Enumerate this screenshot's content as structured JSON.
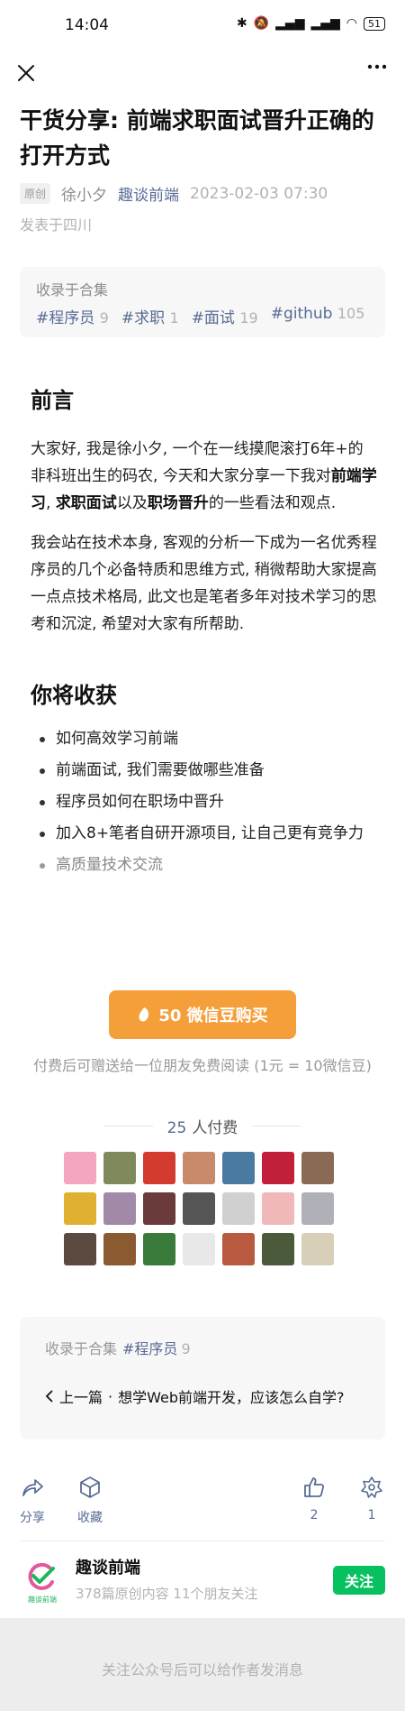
{
  "status_bar": {
    "time": "14:04",
    "icons": [
      "bluetooth-icon",
      "mute-icon",
      "hd-signal-icon",
      "hd-signal-icon",
      "wifi-icon"
    ],
    "battery": "51"
  },
  "nav": {
    "close_icon": "close-icon",
    "more_icon": "more-icon"
  },
  "article": {
    "title": "干货分享: 前端求职面试晋升正确的打开方式",
    "original_tag": "原创",
    "author": "徐小夕",
    "account": "趣谈前端",
    "date": "2023-02-03 07:30",
    "location": "发表于四川"
  },
  "collection": {
    "label": "收录于合集",
    "tags": [
      {
        "name": "#程序员",
        "count": "9"
      },
      {
        "name": "#求职",
        "count": "1"
      },
      {
        "name": "#面试",
        "count": "19"
      },
      {
        "name": "#github",
        "count": "105"
      }
    ]
  },
  "content": {
    "section1_title": "前言",
    "para1": {
      "t1": "大家好, 我是徐小夕, 一个在一线摸爬滚打6年+的非科班出生的码农, 今天和大家分享一下我对",
      "b1": "前端学习",
      "t2": ", ",
      "b2": "求职面试",
      "t3": "以及",
      "b3": "职场晋升",
      "t4": "的一些看法和观点."
    },
    "para2": "我会站在技术本身, 客观的分析一下成为一名优秀程序员的几个必备特质和思维方式, 稍微帮助大家提高一点点技术格局, 此文也是笔者多年对技术学习的思考和沉淀, 希望对大家有所帮助.",
    "section2_title": "你将收获",
    "bullets": [
      "如何高效学习前端",
      "前端面试, 我们需要做哪些准备",
      "程序员如何在职场中晋升",
      "加入8+笔者自研开源项目, 让自己更有竞争力",
      "高质量技术交流"
    ]
  },
  "purchase": {
    "button_label": "50 微信豆购买",
    "gift_note": "付费后可赠送给一位朋友免费阅读 (1元 = 10微信豆)",
    "payers_count": "25",
    "payers_label": "人付费",
    "avatar_colors": [
      "#f4a5c0",
      "#7e8a5c",
      "#d33b2e",
      "#c98a6b",
      "#4a7aa0",
      "#c2203a",
      "#8a6a55",
      "#e0b030",
      "#a08aa8",
      "#6b3b3b",
      "#555555",
      "#d0d0d0",
      "#f0b8b8",
      "#b0b0b8",
      "#5a4a40",
      "#8a5a30",
      "#3a7a3a",
      "#e8e8e8",
      "#b85a40",
      "#4a5a3a",
      "#d8cfb8"
    ]
  },
  "collection_footer": {
    "label": "收录于合集",
    "name": "#程序员",
    "count": "9",
    "prev_label": "上一篇",
    "prev_sep": "·",
    "prev_title": "想学Web前端开发，应该怎么自学?"
  },
  "actions": {
    "share": "分享",
    "favorite": "收藏",
    "like_count": "2",
    "wow_count": "1"
  },
  "account_card": {
    "name": "趣谈前端",
    "stats": "378篇原创内容  11个朋友关注",
    "logo_text": "趣谈前端",
    "follow": "关注"
  },
  "footer": {
    "text": "关注公众号后可以给作者发消息"
  },
  "colors": {
    "link": "#576b95",
    "buy_button": "#f59f3b",
    "follow_button": "#07c160"
  }
}
